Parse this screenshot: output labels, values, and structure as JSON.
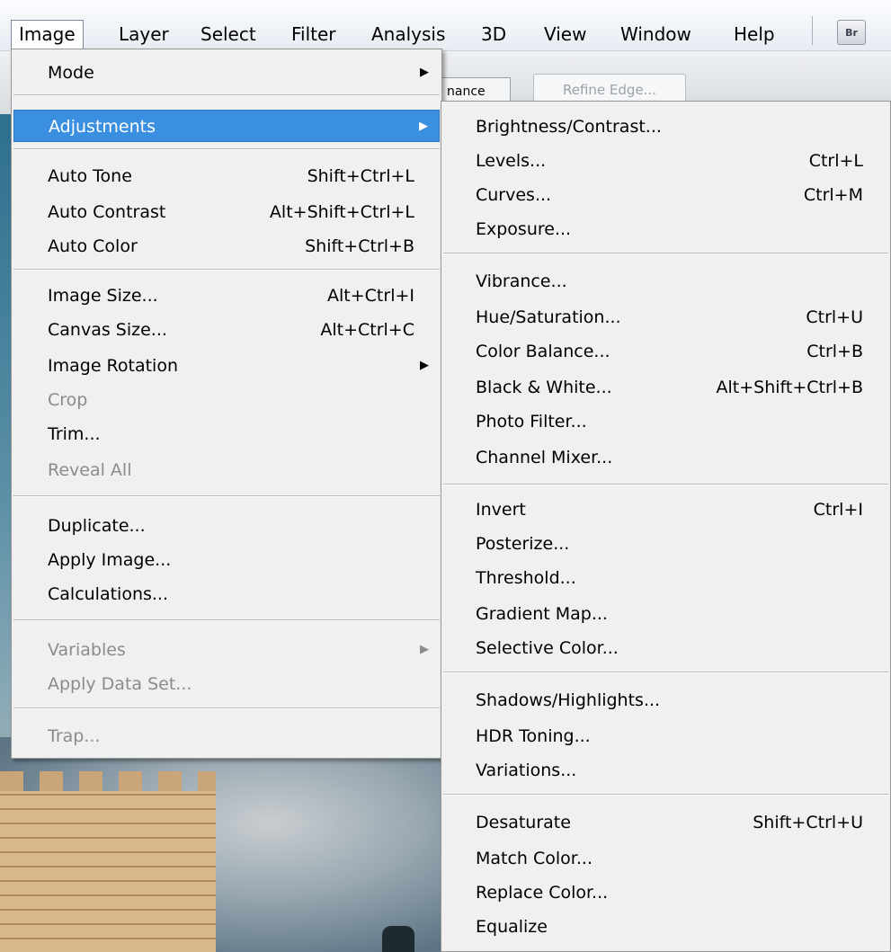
{
  "menubar": {
    "items": [
      "Image",
      "Layer",
      "Select",
      "Filter",
      "Analysis",
      "3D",
      "View",
      "Window",
      "Help"
    ],
    "bridge_label": "Br"
  },
  "background": {
    "tab_label": "nance",
    "refine_edge_label": "Refine Edge..."
  },
  "image_menu": {
    "mode": "Mode",
    "adjustments": "Adjustments",
    "auto_tone": "Auto Tone",
    "auto_tone_sc": "Shift+Ctrl+L",
    "auto_contrast": "Auto Contrast",
    "auto_contrast_sc": "Alt+Shift+Ctrl+L",
    "auto_color": "Auto Color",
    "auto_color_sc": "Shift+Ctrl+B",
    "image_size": "Image Size...",
    "image_size_sc": "Alt+Ctrl+I",
    "canvas_size": "Canvas Size...",
    "canvas_size_sc": "Alt+Ctrl+C",
    "image_rotation": "Image Rotation",
    "crop": "Crop",
    "trim": "Trim...",
    "reveal_all": "Reveal All",
    "duplicate": "Duplicate...",
    "apply_image": "Apply Image...",
    "calculations": "Calculations...",
    "variables": "Variables",
    "apply_data_set": "Apply Data Set...",
    "trap": "Trap..."
  },
  "adjust_menu": {
    "brightness_contrast": "Brightness/Contrast...",
    "levels": "Levels...",
    "levels_sc": "Ctrl+L",
    "curves": "Curves...",
    "curves_sc": "Ctrl+M",
    "exposure": "Exposure...",
    "vibrance": "Vibrance...",
    "hue_saturation": "Hue/Saturation...",
    "hue_saturation_sc": "Ctrl+U",
    "color_balance": "Color Balance...",
    "color_balance_sc": "Ctrl+B",
    "black_white": "Black & White...",
    "black_white_sc": "Alt+Shift+Ctrl+B",
    "photo_filter": "Photo Filter...",
    "channel_mixer": "Channel Mixer...",
    "invert": "Invert",
    "invert_sc": "Ctrl+I",
    "posterize": "Posterize...",
    "threshold": "Threshold...",
    "gradient_map": "Gradient Map...",
    "selective_color": "Selective Color...",
    "shadows_highlights": "Shadows/Highlights...",
    "hdr_toning": "HDR Toning...",
    "variations": "Variations...",
    "desaturate": "Desaturate",
    "desaturate_sc": "Shift+Ctrl+U",
    "match_color": "Match Color...",
    "replace_color": "Replace Color...",
    "equalize": "Equalize"
  },
  "colors": {
    "highlight": "#3b8fe0",
    "menu_background": "#f0f0f0",
    "disabled_text": "#8b8b8b"
  }
}
